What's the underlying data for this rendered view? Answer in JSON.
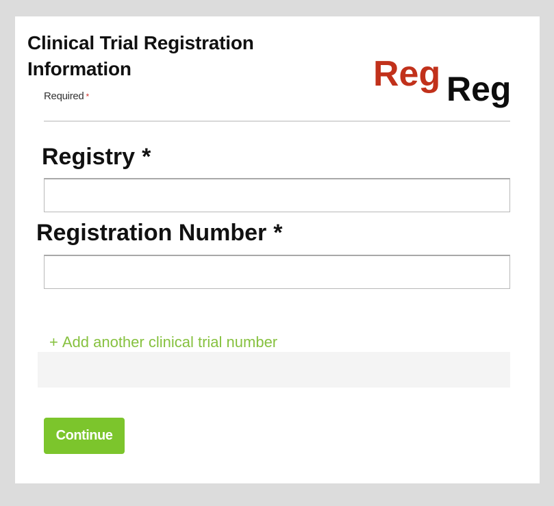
{
  "form": {
    "title_line1": "Clinical Trial Registration",
    "title_line2": "Information",
    "required_label": "Required",
    "required_marker": "*",
    "divider": true
  },
  "overlay": {
    "reg_red": "Reg",
    "reg_black": "Reg",
    "reg_red_color": "#c1311b",
    "reg_black_color": "#0d0d0d"
  },
  "fields": {
    "registry": {
      "label": "Registry",
      "required_marker": "*",
      "value": "",
      "placeholder": ""
    },
    "registration_number": {
      "label": "Registration Number",
      "required_marker": "*",
      "value": "",
      "placeholder": ""
    }
  },
  "actions": {
    "add_plus": "+",
    "add_another_label": "Add another clinical trial number",
    "continue_label": "Continue"
  },
  "colors": {
    "accent_green": "#7cc52c",
    "link_green": "#86c13f",
    "required_red": "#d0302a",
    "page_background": "#dcdcdc",
    "panel_gray": "#f4f4f4"
  }
}
